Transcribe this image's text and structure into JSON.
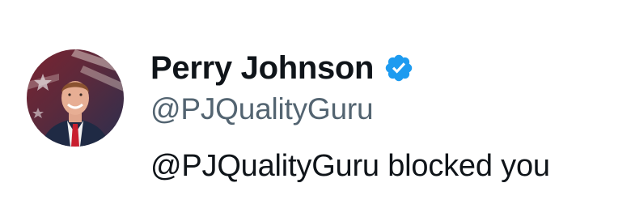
{
  "profile": {
    "display_name": "Perry Johnson",
    "handle": "@PJQualityGuru",
    "verified": true,
    "avatar_icon": "profile-photo"
  },
  "notice": {
    "message": "@PJQualityGuru blocked you"
  },
  "colors": {
    "name_text": "#0f1419",
    "handle_text": "#536471",
    "verified_badge": "#1d9bf0",
    "background": "#ffffff"
  }
}
